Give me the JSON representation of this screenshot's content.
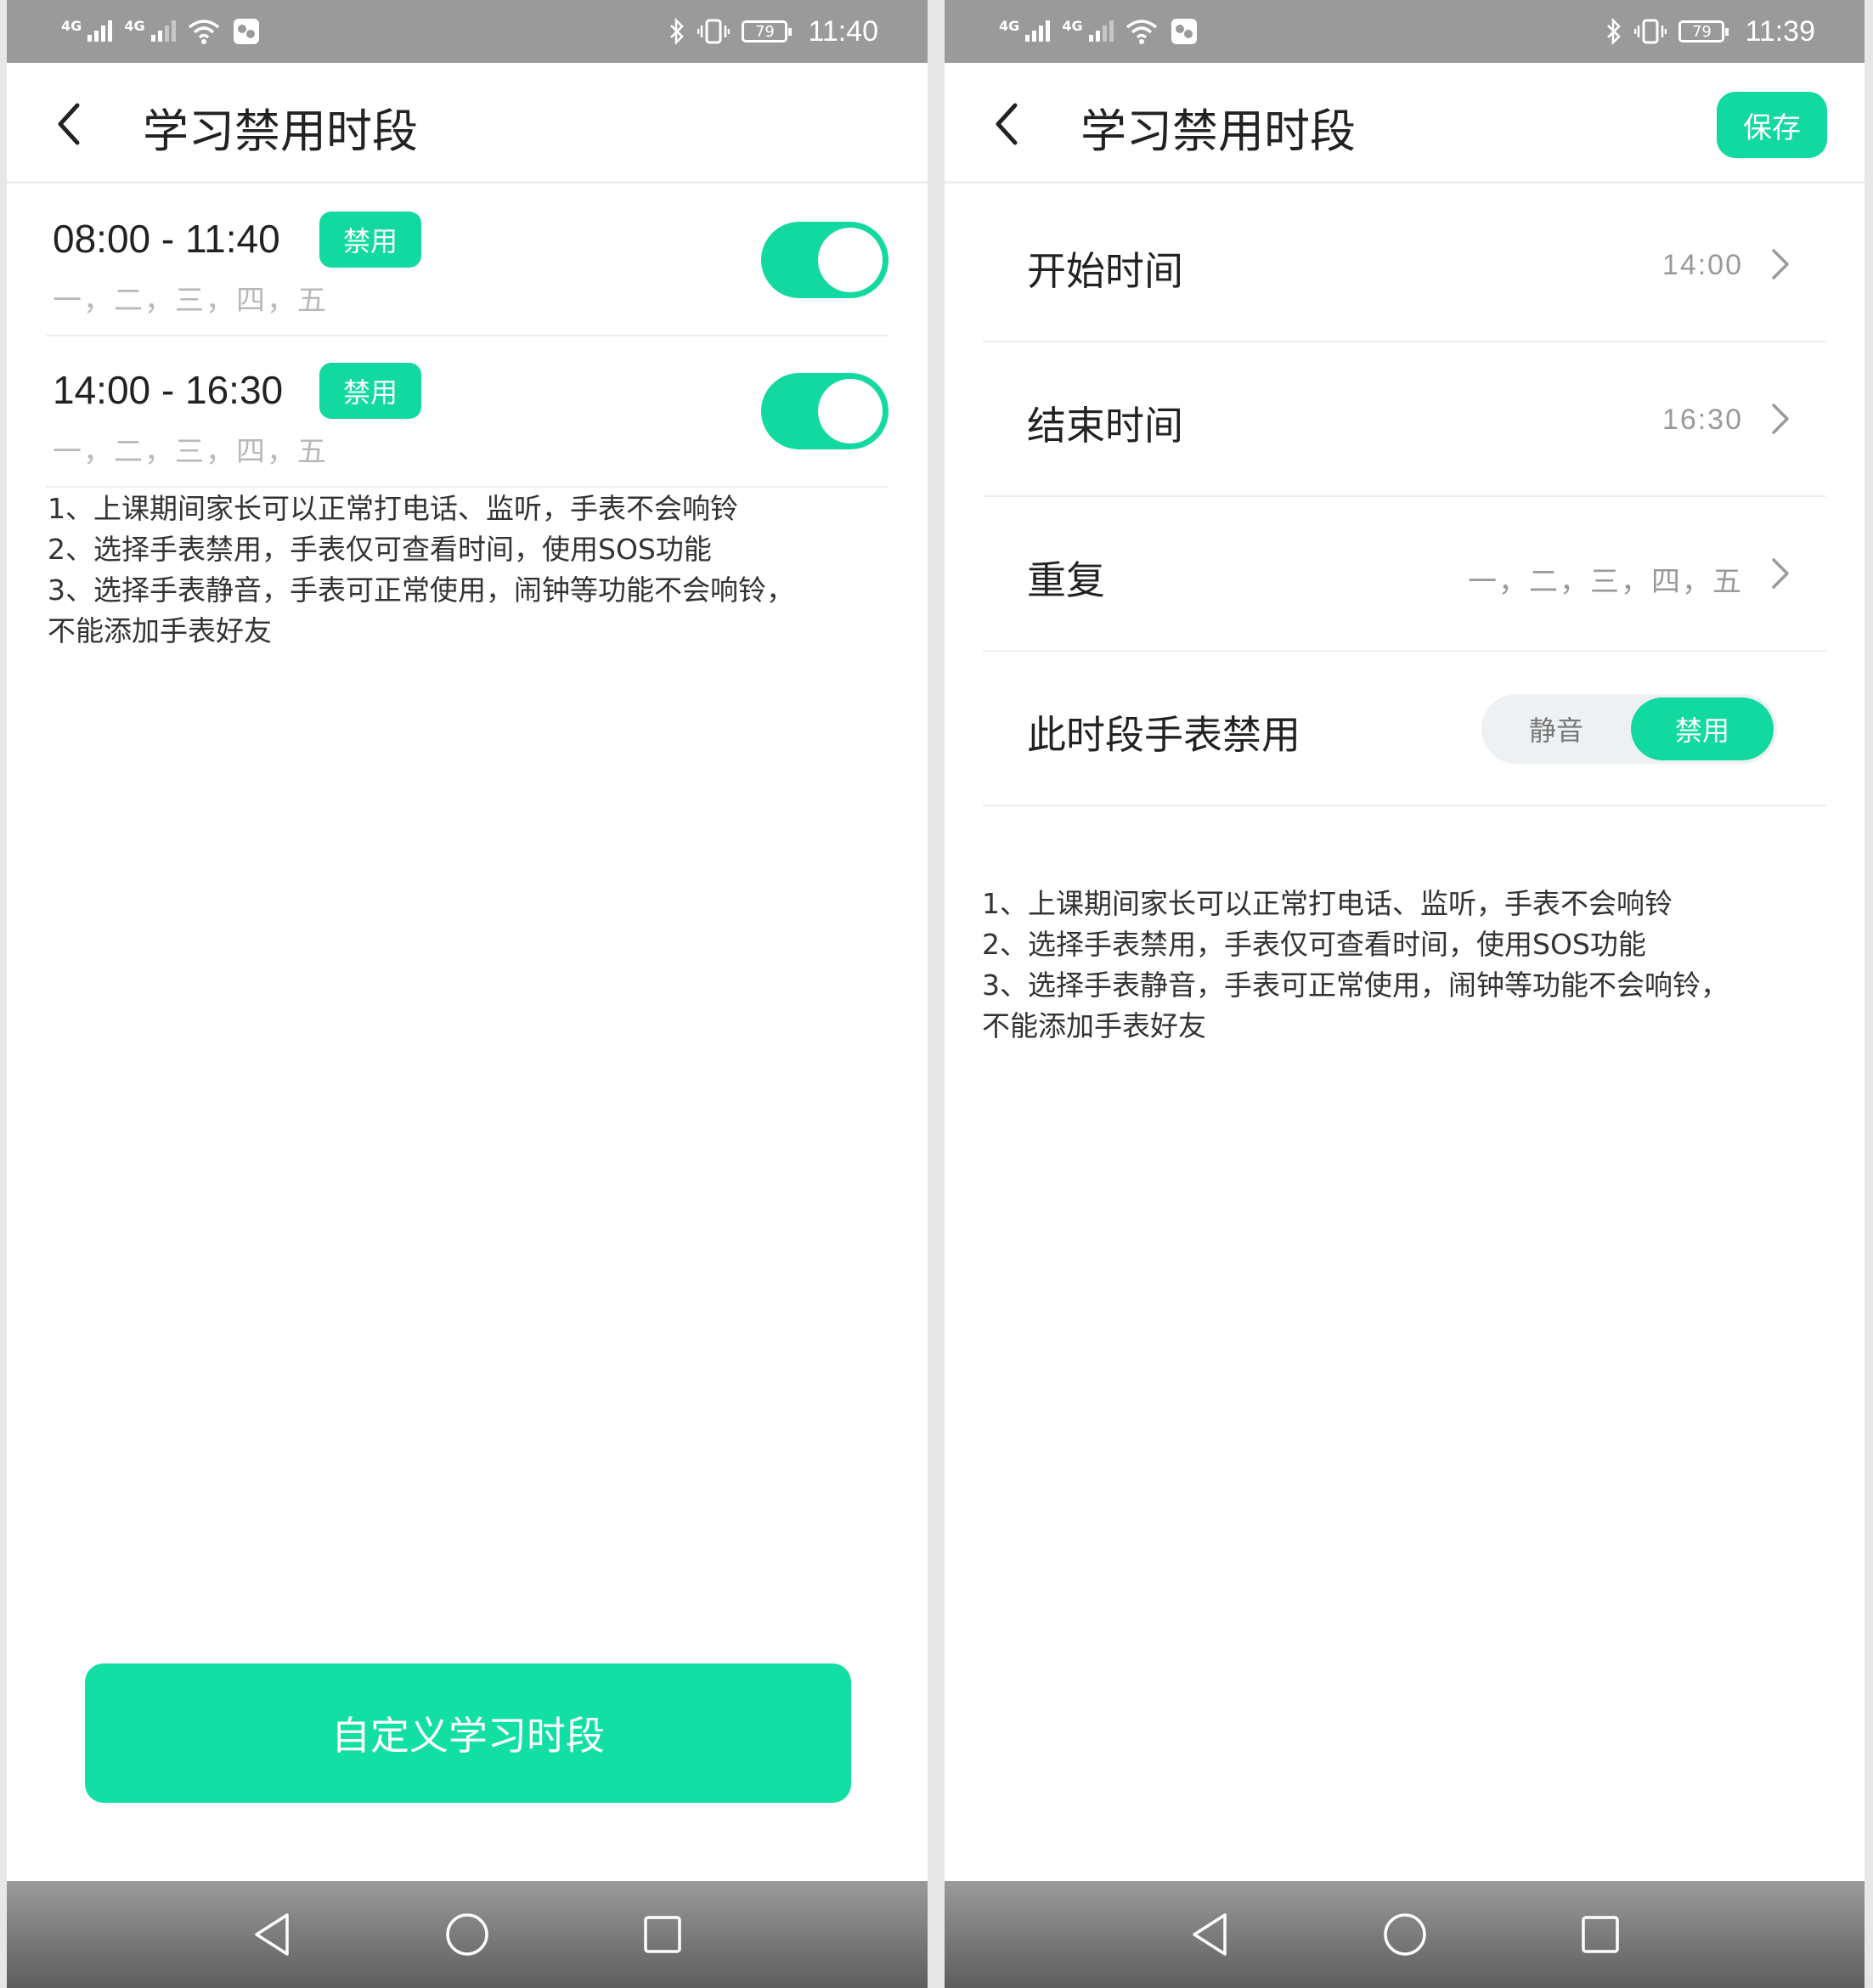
{
  "colors": {
    "accent": "#12d9a0",
    "status_bar": "#9a9a9a",
    "nav_bar": "#6e6e6e",
    "muted_text": "#b8b8b8"
  },
  "left_screen": {
    "status_bar": {
      "network_1": "4G",
      "network_2": "4G",
      "battery": "79",
      "time": "11:40"
    },
    "header": {
      "title": "学习禁用时段"
    },
    "periods": [
      {
        "time_range": "08:00 - 11:40",
        "badge": "禁用",
        "days": "一，二，三，四，五",
        "enabled": true
      },
      {
        "time_range": "14:00 - 16:30",
        "badge": "禁用",
        "days": "一，二，三，四，五",
        "enabled": true
      }
    ],
    "notes": [
      "1、上课期间家长可以正常打电话、监听，手表不会响铃",
      "2、选择手表禁用，手表仅可查看时间，使用SOS功能",
      "3、选择手表静音，手表可正常使用，闹钟等功能不会响铃，",
      "不能添加手表好友"
    ],
    "custom_button_label": "自定义学习时段"
  },
  "right_screen": {
    "status_bar": {
      "network_1": "4G",
      "network_2": "4G",
      "battery": "79",
      "time": "11:39"
    },
    "header": {
      "title": "学习禁用时段",
      "save_label": "保存"
    },
    "settings": {
      "start": {
        "label": "开始时间",
        "value": "14:00"
      },
      "end": {
        "label": "结束时间",
        "value": "16:30"
      },
      "repeat": {
        "label": "重复",
        "value": "一，二，三，四，五"
      },
      "mode": {
        "label": "此时段手表禁用",
        "options": [
          "静音",
          "禁用"
        ],
        "selected": "禁用"
      }
    },
    "notes": [
      "1、上课期间家长可以正常打电话、监听，手表不会响铃",
      "2、选择手表禁用，手表仅可查看时间，使用SOS功能",
      "3、选择手表静音，手表可正常使用，闹钟等功能不会响铃，",
      "不能添加手表好友"
    ]
  },
  "icons": {
    "back": "chevron-left-icon",
    "chevron": "chevron-right-icon",
    "wifi": "wifi-icon",
    "bluetooth": "bluetooth-icon",
    "vibrate": "vibrate-icon",
    "nav_back": "triangle-back-icon",
    "nav_home": "circle-home-icon",
    "nav_recent": "square-recent-icon"
  }
}
